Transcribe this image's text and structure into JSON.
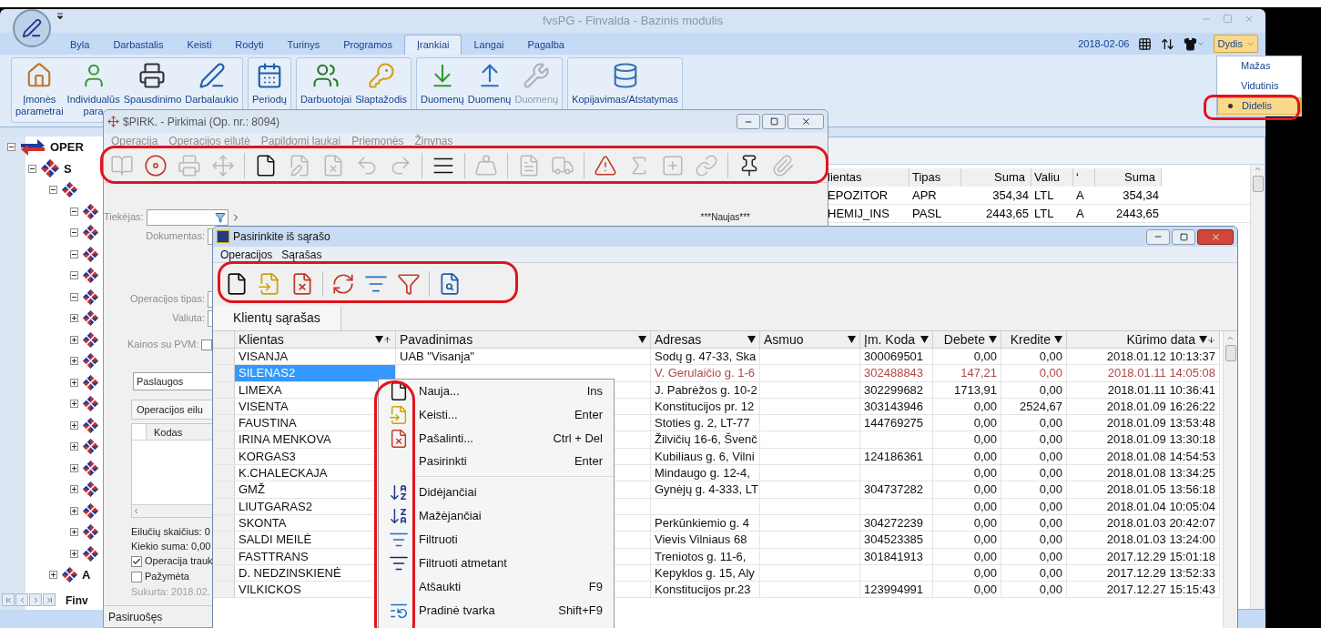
{
  "app_window": {
    "title": "fvsPG - Finvalda - Bazinis modulis"
  },
  "ribbon_tabs": [
    {
      "label": "Byla",
      "selected": false
    },
    {
      "label": "Darbastalis",
      "selected": false
    },
    {
      "label": "Keisti",
      "selected": false
    },
    {
      "label": "Rodyti",
      "selected": false
    },
    {
      "label": "Turinys",
      "selected": false
    },
    {
      "label": "Programos",
      "selected": false
    },
    {
      "label": "Įrankiai",
      "selected": true
    },
    {
      "label": "Langai",
      "selected": false
    },
    {
      "label": "Pagalba",
      "selected": false
    }
  ],
  "header_right": {
    "date": "2018-02-06",
    "size_button": "Dydis",
    "size_menu": [
      {
        "label": "Mažas",
        "selected": false
      },
      {
        "label": "Vidutinis",
        "selected": false
      },
      {
        "label": "Didelis",
        "selected": true
      }
    ]
  },
  "ribbon_groups": [
    {
      "buttons": [
        {
          "lines": [
            "Įmonės",
            "parametrai"
          ],
          "disabled": false
        },
        {
          "lines": [
            "Individualūs",
            "para"
          ],
          "disabled": false
        },
        {
          "lines": [
            "Spausdinimo"
          ],
          "disabled": false
        },
        {
          "lines": [
            "Darbalaukio"
          ],
          "disabled": false
        }
      ]
    },
    {
      "buttons": [
        {
          "lines": [
            "Periodų"
          ],
          "disabled": false
        }
      ]
    },
    {
      "buttons": [
        {
          "lines": [
            "Darbuotojai"
          ],
          "disabled": false
        },
        {
          "lines": [
            "Slaptažodis"
          ],
          "disabled": false
        }
      ]
    },
    {
      "buttons": [
        {
          "lines": [
            "Duomenų"
          ],
          "disabled": false
        },
        {
          "lines": [
            "Duomenų"
          ],
          "disabled": false
        },
        {
          "lines": [
            "Duomenų"
          ],
          "disabled": true
        }
      ]
    },
    {
      "buttons": [
        {
          "lines": [
            "Kopijavimas/Atstatymas"
          ],
          "disabled": false
        }
      ]
    }
  ],
  "tree": [
    {
      "label": "OPER",
      "expanded": true,
      "children": [
        {
          "label": "S",
          "expanded": true,
          "children": [
            {
              "expanded": true,
              "children": [
                {
                  "expanded": true
                },
                {
                  "expanded": true
                },
                {
                  "expanded": true
                },
                {
                  "expanded": true
                },
                {
                  "expanded": true
                },
                {
                  "expanded": false
                },
                {
                  "expanded": false
                },
                {
                  "expanded": false
                },
                {
                  "expanded": false
                },
                {
                  "expanded": false
                },
                {
                  "expanded": false
                },
                {
                  "expanded": false
                },
                {
                  "expanded": false
                },
                {
                  "expanded": false
                },
                {
                  "expanded": false
                },
                {
                  "expanded": false
                },
                {
                  "expanded": false
                }
              ]
            },
            {
              "label": "A",
              "expanded": false
            }
          ]
        }
      ]
    }
  ],
  "tree_tab": "Finv",
  "background_table": {
    "columns": [
      "lientas",
      "Tipas",
      "Suma",
      "Valiu",
      "‘",
      "Suma"
    ],
    "rows": [
      [
        "EPOZITOR",
        "APR",
        "354,34",
        "LTL",
        "A",
        "354,34"
      ],
      [
        "HEMIJ_INS",
        "PASL",
        "2443,65",
        "LTL",
        "A",
        "2443,65"
      ]
    ]
  },
  "purchase_window": {
    "title": "$PIRK. - Pirkimai (Op. nr.: 8094)",
    "menu": [
      "Operacija",
      "Operacijos eilutė",
      "Papildomi laukai",
      "Priemonės",
      "Žinynas"
    ],
    "toolbar": [
      {
        "kind": "button",
        "disabled": true
      },
      {
        "kind": "button",
        "disabled": false
      },
      {
        "kind": "button",
        "disabled": true
      },
      {
        "kind": "button",
        "disabled": true
      },
      {
        "kind": "separator"
      },
      {
        "kind": "button",
        "disabled": false
      },
      {
        "kind": "button",
        "disabled": true
      },
      {
        "kind": "button",
        "disabled": true
      },
      {
        "kind": "button",
        "disabled": true
      },
      {
        "kind": "button",
        "disabled": true
      },
      {
        "kind": "separator"
      },
      {
        "kind": "button",
        "disabled": false
      },
      {
        "kind": "separator"
      },
      {
        "kind": "button",
        "disabled": true
      },
      {
        "kind": "separator"
      },
      {
        "kind": "button",
        "disabled": true
      },
      {
        "kind": "button",
        "disabled": true
      },
      {
        "kind": "separator"
      },
      {
        "kind": "button",
        "disabled": false
      },
      {
        "kind": "button",
        "disabled": true
      },
      {
        "kind": "button",
        "disabled": true
      },
      {
        "kind": "button",
        "disabled": true
      },
      {
        "kind": "separator"
      },
      {
        "kind": "button",
        "disabled": false
      },
      {
        "kind": "button",
        "disabled": true
      }
    ],
    "state_label": "***Naujas***",
    "fields": [
      {
        "label": "Tiekėjas:",
        "kind": "lookup"
      },
      {
        "label": "Dokumentas:",
        "kind": "text"
      },
      {
        "label": "Operacijos tipas:",
        "kind": "text"
      },
      {
        "label": "Valiuta:",
        "kind": "text"
      },
      {
        "label": "Kainos su PVM:",
        "kind": "checkbox",
        "checked": false
      }
    ],
    "category": "Paslaugos",
    "lines_tab": "Operacijos eilu",
    "lines_column": "Kodas",
    "line_count": "Eilučių skaičius: 0",
    "qty_sum": "Kiekio suma: 0,00",
    "checks": [
      {
        "label": "Operacija trauk",
        "checked": true
      },
      {
        "label": "Pažymėta",
        "checked": false
      }
    ],
    "created": "Sukurta: 2018.02.",
    "status_bar": "Pasiruošęs"
  },
  "picker_window": {
    "title": "Pasirinkite iš sąrašo",
    "menu": [
      "Operacijos",
      "Sąrašas"
    ],
    "toolbar": [
      {
        "kind": "button"
      },
      {
        "kind": "button"
      },
      {
        "kind": "button"
      },
      {
        "kind": "separator"
      },
      {
        "kind": "button"
      },
      {
        "kind": "button"
      },
      {
        "kind": "button"
      },
      {
        "kind": "separator"
      },
      {
        "kind": "button"
      }
    ],
    "tab": "Klientų sąrašas",
    "columns": [
      {
        "label": "Klientas",
        "sorted_ascending": true,
        "sorted_descending": false
      },
      {
        "label": "Pavadinimas",
        "sorted_ascending": false,
        "sorted_descending": false
      },
      {
        "label": "Adresas",
        "sorted_ascending": false,
        "sorted_descending": false
      },
      {
        "label": "Asmuo",
        "sorted_ascending": false,
        "sorted_descending": false
      },
      {
        "label": "Įm. Koda",
        "sorted_ascending": false,
        "sorted_descending": false
      },
      {
        "label": "Debete",
        "sorted_ascending": false,
        "sorted_descending": false
      },
      {
        "label": "Kredite",
        "sorted_ascending": false,
        "sorted_descending": false
      },
      {
        "label": "Kūrimo data",
        "sorted_ascending": false,
        "sorted_descending": true
      }
    ],
    "rows": [
      {
        "klientas": "VISANJA",
        "pavadinimas": "UAB \"Visanja\"",
        "adresas": "Sodų g. 47-33, Ska",
        "kodas": "300069501",
        "debete": "0,00",
        "kredite": "0,00",
        "data": "2018.01.12 10:13:37",
        "selected": false
      },
      {
        "klientas": "SILENAS2",
        "adresas": "V. Gerulaičio g. 1-6",
        "kodas": "302488843",
        "debete": "147,21",
        "kredite": "0,00",
        "data": "2018.01.11 14:05:08",
        "selected": true
      },
      {
        "klientas": "LIMEXA",
        "adresas": "J. Pabrėžos g. 10-2",
        "kodas": "302299682",
        "debete": "1713,91",
        "kredite": "0,00",
        "data": "2018.01.11 10:36:41",
        "selected": false
      },
      {
        "klientas": "VISENTA",
        "adresas": "Konstitucijos pr. 12",
        "kodas": "303143946",
        "debete": "0,00",
        "kredite": "2524,67",
        "data": "2018.01.09 16:26:22",
        "selected": false
      },
      {
        "klientas": "FAUSTINA",
        "adresas": "Stoties g. 2, LT-77",
        "kodas": "144769275",
        "debete": "0,00",
        "kredite": "0,00",
        "data": "2018.01.09 13:53:48",
        "selected": false
      },
      {
        "klientas": "IRINA MENKOVA",
        "adresas": "Žilvičių 16-6, Švenč",
        "debete": "0,00",
        "kredite": "0,00",
        "data": "2018.01.09 13:30:18",
        "selected": false
      },
      {
        "klientas": "KORGAS3",
        "adresas": "Kubiliaus g. 6, Vilni",
        "kodas": "124186361",
        "debete": "0,00",
        "kredite": "0,00",
        "data": "2018.01.08 14:54:53",
        "selected": false
      },
      {
        "klientas": "K.CHALECKAJA",
        "adresas": "Mindaugo g. 12-4,",
        "debete": "0,00",
        "kredite": "0,00",
        "data": "2018.01.08 13:34:25",
        "selected": false
      },
      {
        "klientas": "GMŽ",
        "adresas": "Gynėjų g. 4-333, LT",
        "kodas": "304737282",
        "debete": "0,00",
        "kredite": "0,00",
        "data": "2018.01.05 13:56:18",
        "selected": false
      },
      {
        "klientas": "LIUTGARAS2",
        "debete": "0,00",
        "kredite": "0,00",
        "data": "2018.01.04 10:05:04",
        "selected": false
      },
      {
        "klientas": "SKONTA",
        "adresas": "Perkūnkiemio g. 4",
        "kodas": "304272239",
        "debete": "0,00",
        "kredite": "0,00",
        "data": "2018.01.03 20:42:07",
        "selected": false
      },
      {
        "klientas": "SALDI MEILĖ",
        "adresas": "Vievis Vilniaus 68",
        "kodas": "304523385",
        "debete": "0,00",
        "kredite": "0,00",
        "data": "2018.01.03 13:24:00",
        "selected": false
      },
      {
        "klientas": "FASTTRANS",
        "adresas": "Treniotos g. 11-6,",
        "kodas": "301841913",
        "debete": "0,00",
        "kredite": "0,00",
        "data": "2017.12.29 15:01:18",
        "selected": false
      },
      {
        "klientas": "D. NEDZINSKIENĖ",
        "adresas": "Kepyklos g. 15, Aly",
        "debete": "0,00",
        "kredite": "0,00",
        "data": "2017.12.29 13:52:33",
        "selected": false
      },
      {
        "klientas": "VILKICKOS",
        "adresas": "Konstitucijos pr.23",
        "kodas": "123994991",
        "debete": "0,00",
        "kredite": "0,00",
        "data": "2017.12.27 15:15:43",
        "selected": false
      }
    ],
    "context_menu": [
      {
        "kind": "item",
        "label": "Nauja...",
        "shortcut": "Ins"
      },
      {
        "kind": "item",
        "label": "Keisti...",
        "shortcut": "Enter"
      },
      {
        "kind": "item",
        "label": "Pašalinti...",
        "shortcut": "Ctrl + Del"
      },
      {
        "kind": "item",
        "label": "Pasirinkti",
        "shortcut": "Enter"
      },
      {
        "kind": "separator"
      },
      {
        "kind": "item",
        "label": "Didėjančiai"
      },
      {
        "kind": "item",
        "label": "Mažėjančiai"
      },
      {
        "kind": "item",
        "label": "Filtruoti"
      },
      {
        "kind": "item",
        "label": "Filtruoti atmetant"
      },
      {
        "kind": "item",
        "label": "Atšaukti",
        "shortcut": "F9"
      },
      {
        "kind": "item",
        "label": "Pradinė tvarka",
        "shortcut": "Shift+F9"
      }
    ]
  }
}
